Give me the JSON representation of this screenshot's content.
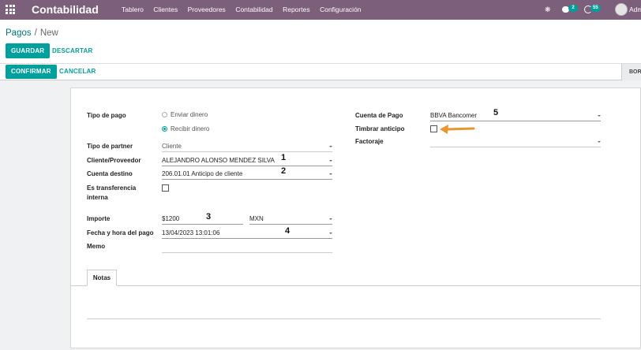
{
  "navbar": {
    "brand": "Contabilidad",
    "menu": [
      "Tablero",
      "Clientes",
      "Proveedores",
      "Contabilidad",
      "Reportes",
      "Configuración"
    ],
    "messages_count": "2",
    "activities_count": "55",
    "user": "Adm"
  },
  "breadcrumb": {
    "parent": "Pagos",
    "separator": "/",
    "current": "New"
  },
  "buttons": {
    "save": "GUARDAR",
    "discard": "DESCARTAR",
    "confirm": "CONFIRMAR",
    "cancel": "CANCELAR",
    "stage": "BOR"
  },
  "form": {
    "payment_type_label": "Tipo de pago",
    "payment_type_options": [
      "Enviar dinero",
      "Recibir dinero"
    ],
    "payment_type_selected": "Recibir dinero",
    "partner_type_label": "Tipo de partner",
    "partner_type_value": "Cliente",
    "partner_label": "Cliente/Proveedor",
    "partner_value": "ALEJANDRO ALONSO MENDEZ SILVA",
    "dest_account_label": "Cuenta destino",
    "dest_account_value": "206.01.01 Anticipo de cliente",
    "internal_transfer_label_1": "Es transferencia",
    "internal_transfer_label_2": "interna",
    "amount_label": "Importe",
    "amount_value": "$1200",
    "currency_value": "MXN",
    "date_label": "Fecha y hora del pago",
    "date_value": "13/04/2023 13:01:06",
    "memo_label": "Memo",
    "payment_account_label": "Cuenta de Pago",
    "payment_account_value": "BBVA Bancomer",
    "stamp_advance_label": "Timbrar anticipo",
    "factoring_label": "Factoraje",
    "notes_tab": "Notas"
  },
  "annotations": {
    "n1": "1",
    "n2": "2",
    "n3": "3",
    "n4": "4",
    "n5": "5",
    "arrow_color": "#e8972e"
  },
  "colors": {
    "navbar": "#7c5f7b",
    "accent": "#00a09d",
    "link": "#00747a"
  }
}
